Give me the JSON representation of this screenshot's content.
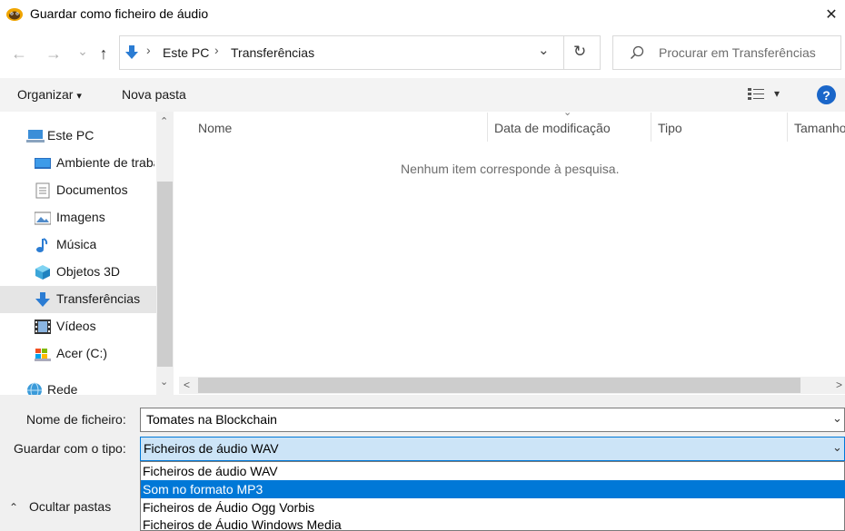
{
  "window": {
    "title": "Guardar como ficheiro de áudio",
    "app_icon": "audacity-icon",
    "close_symbol": "✕"
  },
  "nav": {
    "back_symbol": "←",
    "forward_symbol": "→",
    "recent_symbol": "⌄",
    "up_symbol": "↑",
    "breadcrumb": [
      "Este PC",
      "Transferências"
    ],
    "breadcrumb_sep": "›",
    "history_dropdown": "⌄",
    "refresh_symbol": "↻",
    "search_placeholder": "Procurar em Transferências"
  },
  "toolbar": {
    "organize_label": "Organizar",
    "new_folder_label": "Nova pasta",
    "view_dropdown": "▾",
    "help_label": "?"
  },
  "sidebar": {
    "items": [
      {
        "label": "Este PC",
        "icon": "computer-icon"
      },
      {
        "label": "Ambiente de trabalho",
        "icon": "desktop-icon"
      },
      {
        "label": "Documentos",
        "icon": "documents-icon"
      },
      {
        "label": "Imagens",
        "icon": "pictures-icon"
      },
      {
        "label": "Música",
        "icon": "music-icon"
      },
      {
        "label": "Objetos 3D",
        "icon": "objects-3d-icon"
      },
      {
        "label": "Transferências",
        "icon": "downloads-icon",
        "selected": true
      },
      {
        "label": "Vídeos",
        "icon": "videos-icon"
      },
      {
        "label": "Acer (C:)",
        "icon": "drive-icon"
      },
      {
        "label": "Rede",
        "icon": "network-icon"
      }
    ],
    "scroll_up": "⌃",
    "scroll_down": "⌄"
  },
  "content": {
    "columns": [
      "Nome",
      "Data de modificação",
      "Tipo",
      "Tamanho"
    ],
    "sort_indicator": "⌄",
    "empty_message": "Nenhum item corresponde à pesquisa.",
    "scroll_left": "<",
    "scroll_right": ">"
  },
  "form": {
    "filename_label": "Nome de ficheiro:",
    "filename_value": "Tomates na Blockchain",
    "type_label": "Guardar com o tipo:",
    "type_value": "Ficheiros de áudio WAV",
    "dropdown_arrow": "⌄",
    "type_options": [
      "Ficheiros de áudio WAV",
      "Som no formato MP3",
      "Ficheiros de Áudio Ogg Vorbis",
      "Ficheiros de Áudio Windows Media"
    ],
    "highlighted_option_index": 1,
    "hide_folders_symbol": "⌃",
    "hide_folders_label": "Ocultar pastas"
  },
  "colors": {
    "accent": "#0078d7",
    "selection_bg": "#cce4f7",
    "sidebar_selected": "#e5e5e5",
    "help_blue": "#1a66c9"
  }
}
